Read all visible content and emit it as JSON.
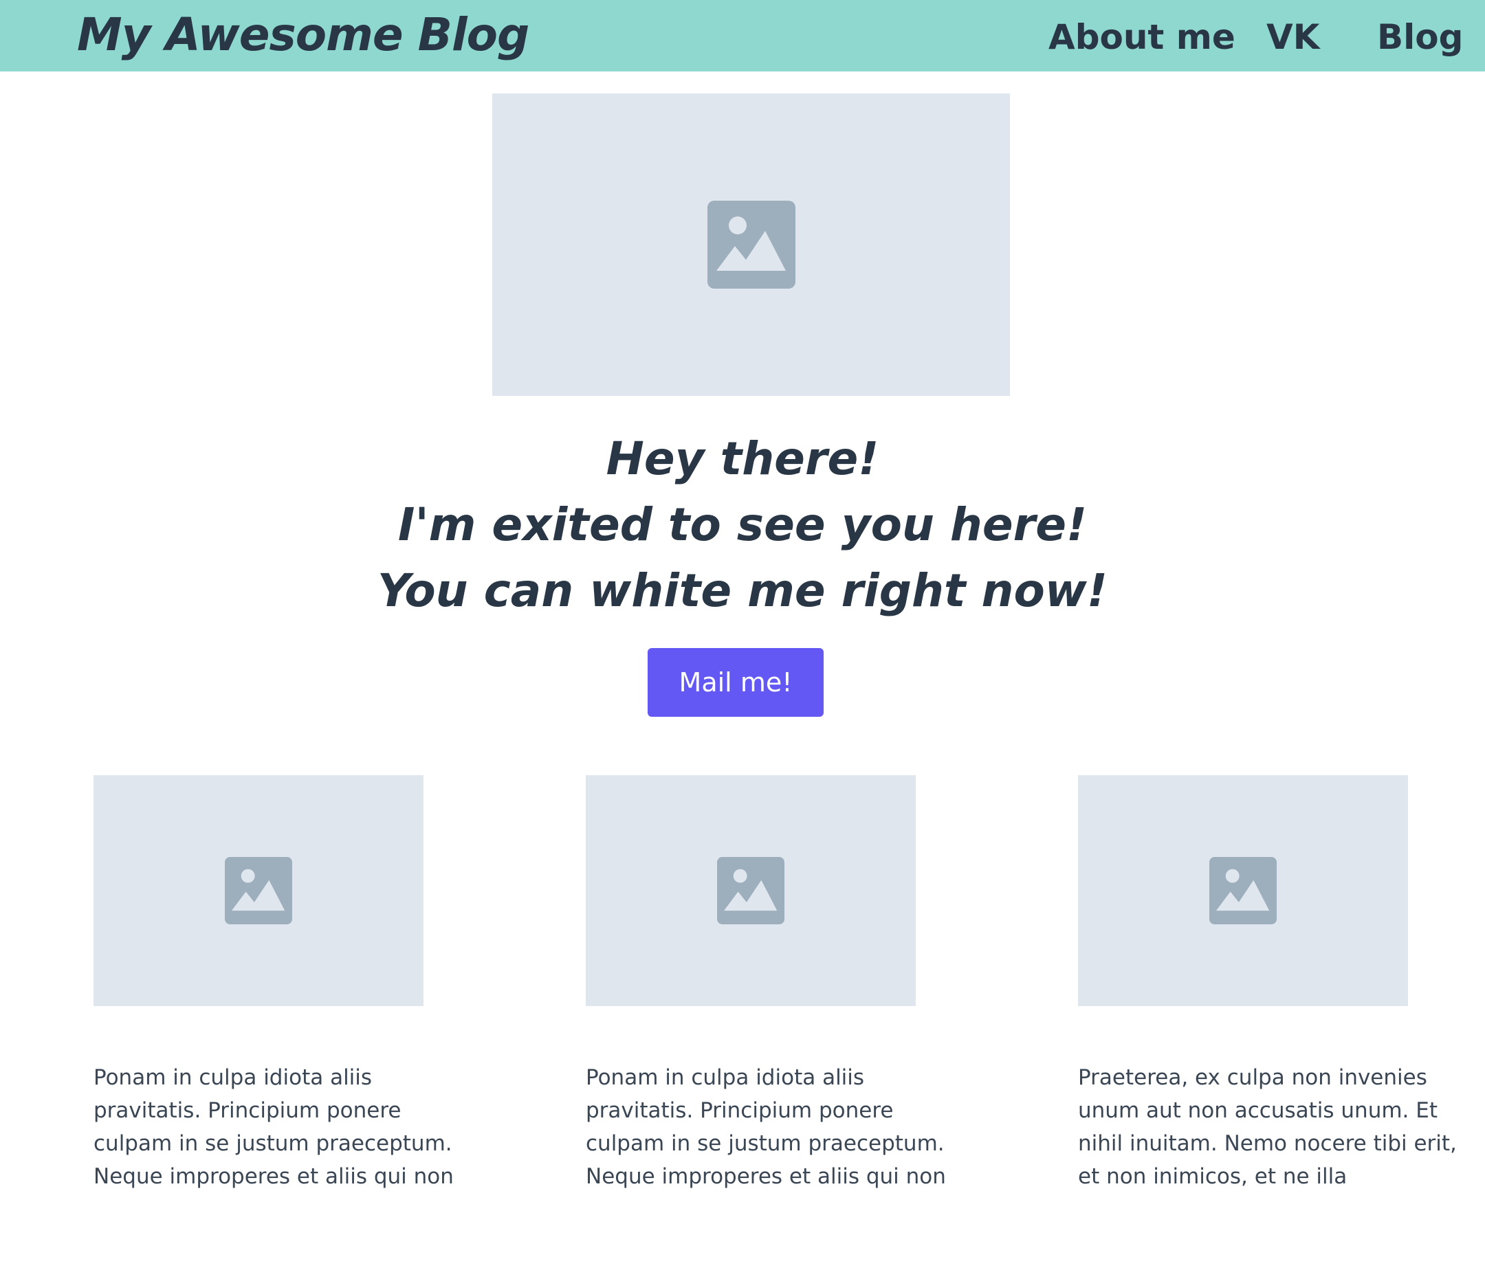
{
  "header": {
    "brand": "My Awesome Blog",
    "nav": [
      {
        "label": "About me"
      },
      {
        "label": "VK"
      },
      {
        "label": "Blog"
      }
    ],
    "background_color": "#8fd8cf"
  },
  "hero": {
    "image_icon": "image-placeholder-icon",
    "lines": [
      "Hey there!",
      "I'm exited to see you here!",
      "You can white me right now!"
    ],
    "button_label": "Mail me!",
    "button_color": "#6358f3"
  },
  "cards": [
    {
      "image_icon": "image-placeholder-icon",
      "lines": [
        "Ponam in culpa idiota aliis",
        "pravitatis. Principium ponere",
        "culpam in se justum praeceptum.",
        "Neque improperes et aliis qui non"
      ]
    },
    {
      "image_icon": "image-placeholder-icon",
      "lines": [
        "Ponam in culpa idiota aliis",
        "pravitatis. Principium ponere",
        "culpam in se justum praeceptum.",
        "Neque improperes et aliis qui non"
      ]
    },
    {
      "image_icon": "image-placeholder-icon",
      "lines": [
        "Praeterea, ex culpa non invenies",
        "unum aut non accusatis unum. Et",
        "nihil inuitam. Nemo nocere tibi erit,",
        "et non inimicos, et ne illa"
      ]
    }
  ]
}
